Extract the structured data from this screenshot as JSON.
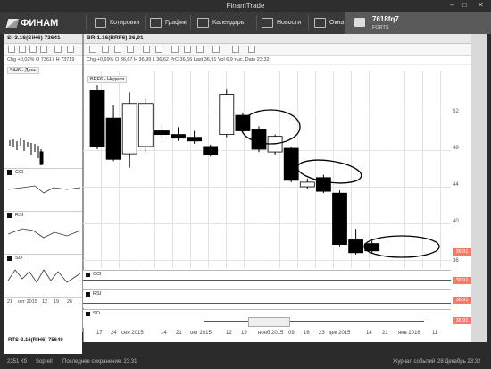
{
  "window": {
    "title": "FinamTrade"
  },
  "nav": {
    "logo": "ФИНАМ",
    "items": [
      "Котировки",
      "График",
      "Календарь",
      "Новости",
      "Окна"
    ],
    "account_id": "7618fq7",
    "account_sub": "FORTS"
  },
  "left_chart": {
    "header": "Si-3.16(SiH6) 73641",
    "info": "Chg +0,02%   O 73617   H 73719",
    "inner_title": "SiH6 - День",
    "indicators": [
      "CCI",
      "RSI",
      "SO"
    ],
    "x_labels": [
      "21",
      "окт 2015",
      "12",
      "19",
      "26"
    ]
  },
  "main_chart": {
    "header": "BR-1.16(BRF6) 36,91",
    "info": "Chg +0,69%   O 36,67   H 36,99   L 36,62   PrC 36,66   Last 36,91   Vol 6,9 тыс.   Date 23:32",
    "inner_title": "BRF6 - Неделя",
    "y_labels": [
      "52",
      "48",
      "44",
      "40",
      "36"
    ],
    "price_tag": "36,91",
    "sub_panes": [
      "CCI",
      "RSI",
      "SO"
    ],
    "x_labels": [
      "17",
      "24",
      "сен 2015",
      "14",
      "21",
      "окт 2015",
      "12",
      "19",
      "нояб 2015",
      "09",
      "16",
      "23",
      "дек 2015",
      "14",
      "21",
      "янв 2016",
      "11"
    ]
  },
  "bottom_left": {
    "label": "RTS-3.16(RIH6) 75640"
  },
  "status": {
    "bytes": "2351 Кб",
    "server": "Soprell",
    "saved": "Последнее сохранение: 23:31",
    "journal": "Журнал событий",
    "datetime": "28 Декабрь 23:32"
  },
  "colors": {
    "accent": "#f47a6a",
    "nav_bg": "#3a3a3a"
  },
  "chart_data": {
    "type": "candlestick",
    "title": "BRF6 - Неделя",
    "ylim": [
      35,
      56
    ],
    "candles": [
      {
        "o": 54.4,
        "c": 48.3,
        "h": 55.0,
        "l": 48.0
      },
      {
        "o": 51.4,
        "c": 46.9,
        "h": 52.8,
        "l": 46.7
      },
      {
        "o": 47.5,
        "c": 53.0,
        "h": 54.2,
        "l": 46.0
      },
      {
        "o": 48.3,
        "c": 53.0,
        "h": 53.5,
        "l": 47.6
      },
      {
        "o": 50.0,
        "c": 49.6,
        "h": 50.6,
        "l": 49.1
      },
      {
        "o": 49.6,
        "c": 49.2,
        "h": 50.4,
        "l": 48.9
      },
      {
        "o": 49.3,
        "c": 48.9,
        "h": 50.0,
        "l": 48.6
      },
      {
        "o": 48.3,
        "c": 47.4,
        "h": 48.5,
        "l": 47.2
      },
      {
        "o": 49.6,
        "c": 54.0,
        "h": 54.5,
        "l": 49.3
      },
      {
        "o": 51.7,
        "c": 50.0,
        "h": 52.0,
        "l": 49.8
      },
      {
        "o": 50.2,
        "c": 48.0,
        "h": 50.5,
        "l": 47.7
      },
      {
        "o": 47.7,
        "c": 49.4,
        "h": 49.6,
        "l": 47.4
      },
      {
        "o": 48.1,
        "c": 44.6,
        "h": 48.3,
        "l": 44.4
      },
      {
        "o": 43.9,
        "c": 44.4,
        "h": 44.8,
        "l": 43.7
      },
      {
        "o": 44.9,
        "c": 43.4,
        "h": 45.2,
        "l": 43.2
      },
      {
        "o": 43.2,
        "c": 37.6,
        "h": 43.5,
        "l": 37.4
      },
      {
        "o": 38.1,
        "c": 36.7,
        "h": 39.3,
        "l": 36.5
      },
      {
        "o": 37.7,
        "c": 36.9,
        "h": 38.0,
        "l": 36.6
      }
    ]
  }
}
